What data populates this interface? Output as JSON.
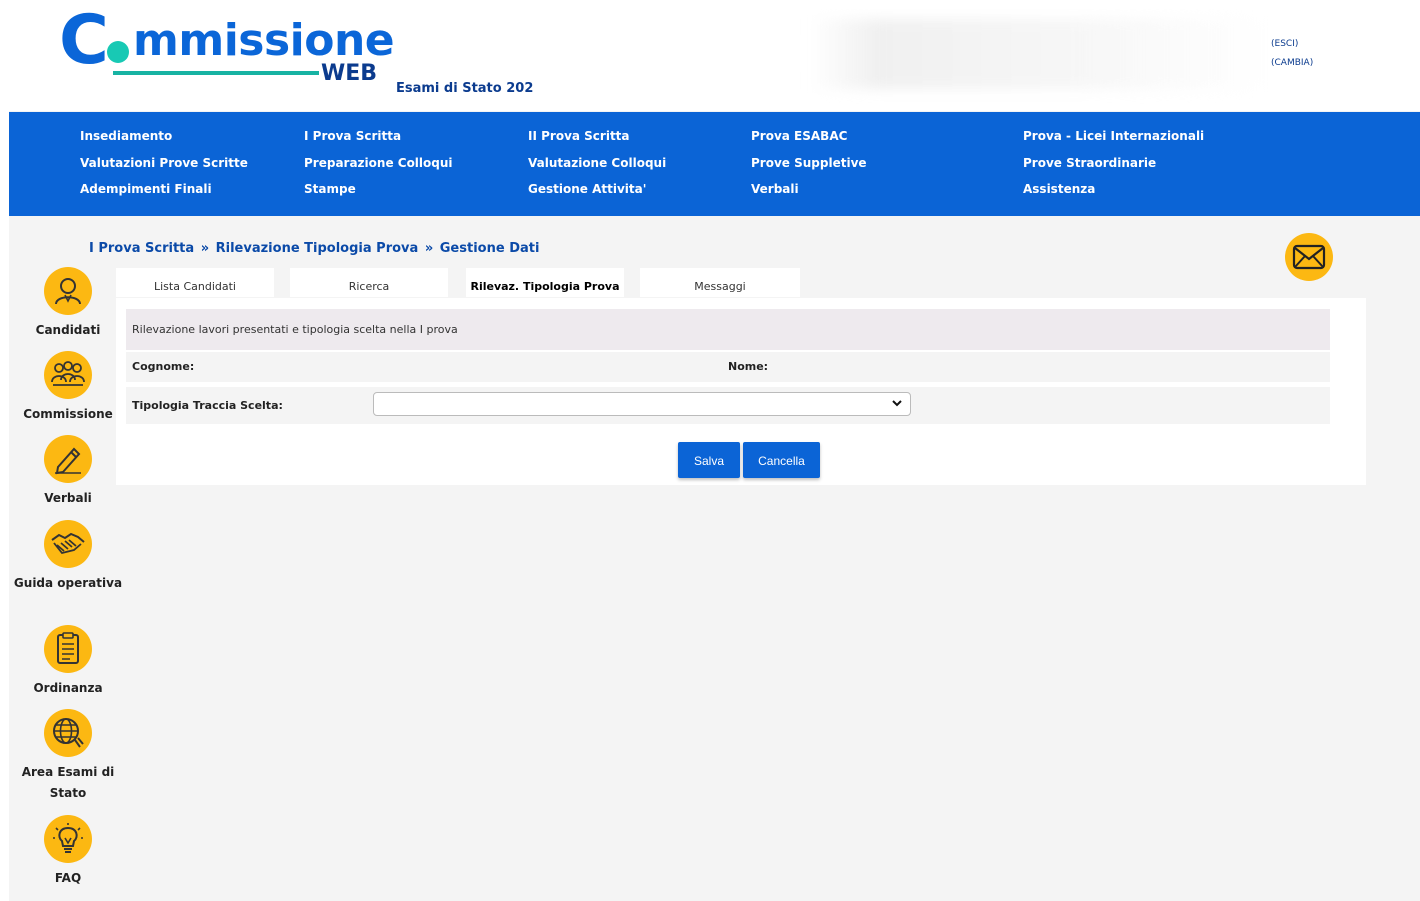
{
  "header": {
    "logo_c": "C",
    "logo_word": "mmissione",
    "logo_web": "WEB",
    "exam_year": "Esami di Stato 202",
    "user_links": [
      "(ESCI)",
      "(CAMBIA)"
    ]
  },
  "topnav": {
    "columns": [
      [
        "Insediamento",
        "Valutazioni Prove Scritte",
        "Adempimenti Finali"
      ],
      [
        "I Prova Scritta",
        "Preparazione Colloqui",
        "Stampe"
      ],
      [
        "II Prova Scritta",
        "Valutazione Colloqui",
        "Gestione Attivita'"
      ],
      [
        "Prova ESABAC",
        "Prove Suppletive",
        "Verbali"
      ],
      [
        "Prova - Licei Internazionali",
        "Prove Straordinarie",
        "Assistenza"
      ]
    ]
  },
  "breadcrumb": [
    "I Prova Scritta",
    "Rilevazione Tipologia Prova",
    "Gestione Dati"
  ],
  "breadcrumb_sep": "»",
  "sidebar": {
    "items": [
      {
        "label": "Candidati",
        "icon": "user-icon"
      },
      {
        "label": "Commissione",
        "icon": "group-icon"
      },
      {
        "label": "Verbali",
        "icon": "pencil-icon"
      },
      {
        "label": "Guida operativa",
        "icon": "handshake-icon"
      },
      {
        "label": "Ordinanza",
        "icon": "document-icon"
      },
      {
        "label": "Area Esami di Stato",
        "icon": "globe-icon"
      },
      {
        "label": "FAQ",
        "icon": "lightbulb-icon"
      }
    ]
  },
  "tabs": [
    {
      "label": "Lista Candidati",
      "active": false
    },
    {
      "label": "Ricerca",
      "active": false
    },
    {
      "label": "Rilevaz. Tipologia Prova",
      "active": true
    },
    {
      "label": "Messaggi",
      "active": false
    }
  ],
  "form": {
    "description": "Rilevazione lavori presentati e tipologia scelta nella I prova",
    "cognome_label": "Cognome:",
    "cognome_value": "",
    "nome_label": "Nome:",
    "nome_value": "",
    "tipologia_label": "Tipologia Traccia Scelta:",
    "tipologia_value": "",
    "save_label": "Salva",
    "cancel_label": "Cancella"
  },
  "colors": {
    "brand_blue": "#0b64d6",
    "accent_yellow": "#fcb812",
    "logo_teal": "#18c9b4"
  }
}
